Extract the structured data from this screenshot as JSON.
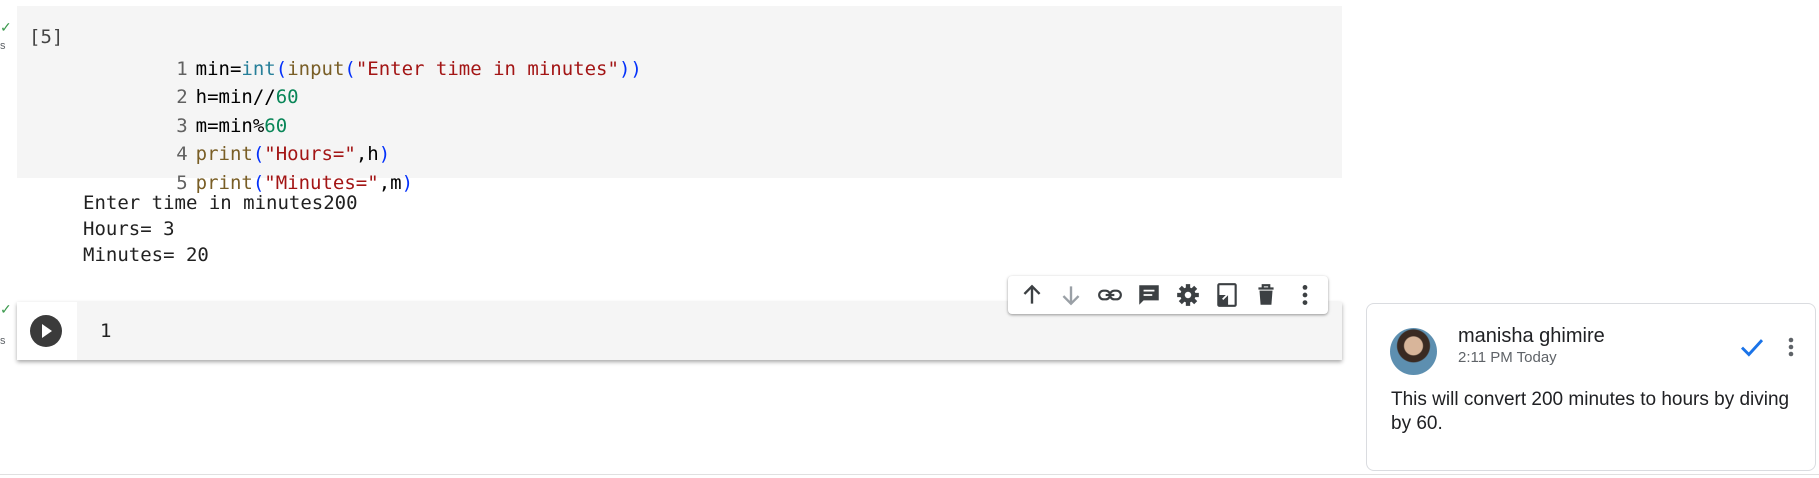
{
  "gutter": {
    "check": "✓",
    "s_label": "s"
  },
  "cell1": {
    "exec_count": "[5]",
    "lines": [
      {
        "n": "1",
        "tokens": [
          "min=",
          "int",
          "(",
          "input",
          "(",
          "\"Enter time in minutes\"",
          "))"
        ]
      },
      {
        "n": "2",
        "tokens": [
          "h=min//",
          "60"
        ]
      },
      {
        "n": "3",
        "tokens": [
          "m=min%",
          "60"
        ]
      },
      {
        "n": "4",
        "tokens": [
          "print",
          "(",
          "\"Hours=\"",
          ",h",
          ")"
        ]
      },
      {
        "n": "5",
        "tokens": [
          "print",
          "(",
          "\"Minutes=\"",
          ",m",
          ")"
        ]
      }
    ],
    "output": [
      "Enter time in minutes200",
      "Hours= 3",
      "Minutes= 20"
    ]
  },
  "toolbar": {
    "buttons": [
      {
        "icon": "arrow-up-icon",
        "label": "Move cell up"
      },
      {
        "icon": "arrow-down-icon",
        "label": "Move cell down"
      },
      {
        "icon": "link-icon",
        "label": "Copy link to cell"
      },
      {
        "icon": "comment-icon",
        "label": "Add comment"
      },
      {
        "icon": "gear-icon",
        "label": "Open editor settings"
      },
      {
        "icon": "mirror-cell-icon",
        "label": "Mirror cell in tab"
      },
      {
        "icon": "trash-icon",
        "label": "Delete cell"
      },
      {
        "icon": "more-vert-icon",
        "label": "More cell actions"
      }
    ]
  },
  "cell2": {
    "line_number": "1"
  },
  "comment": {
    "author": "manisha ghimire",
    "time": "2:11 PM Today",
    "text": "This will convert 200 minutes to hours by diving by 60."
  },
  "colors": {
    "cell_bg": "#f5f5f5",
    "check_green": "#3c9a4e",
    "resolve_blue": "#1a73e8",
    "string": "#a31515",
    "number": "#098658",
    "builtin": "#267f99",
    "function": "#795e26"
  }
}
